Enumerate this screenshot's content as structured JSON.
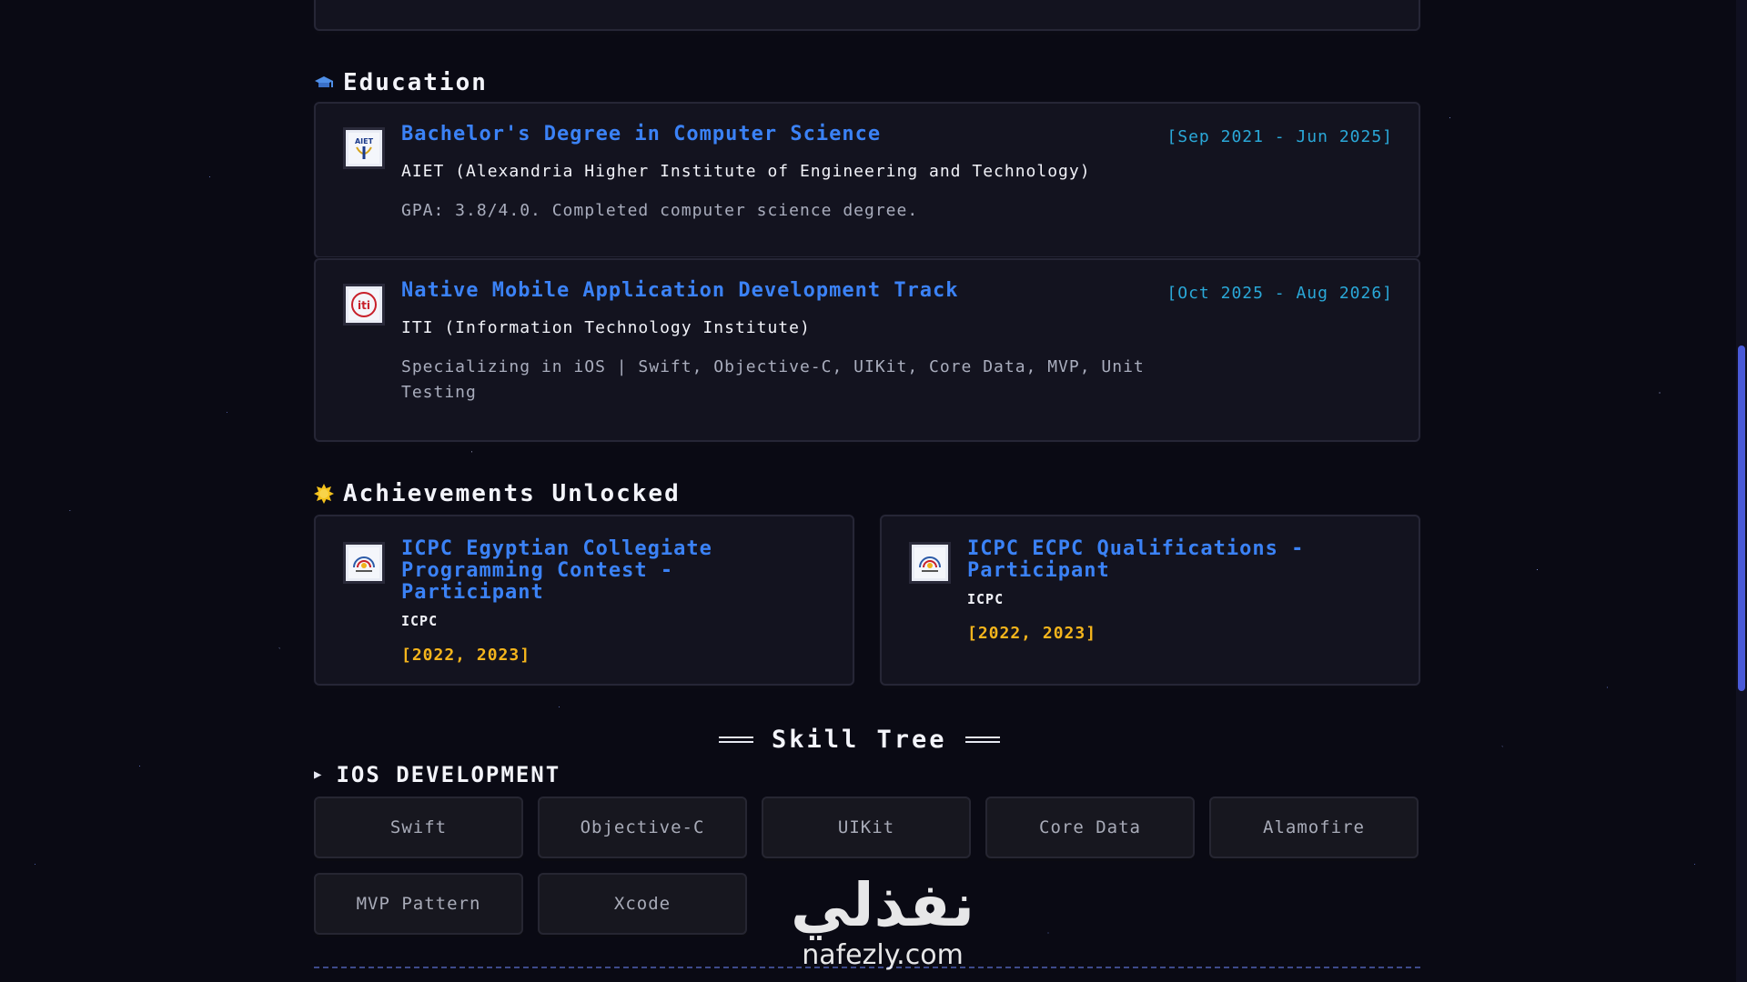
{
  "education": {
    "title": "Education",
    "entries": [
      {
        "logo_text": "AIET",
        "title": "Bachelor's Degree in Computer Science",
        "date": "[Sep 2021 - Jun 2025]",
        "org": "AIET (Alexandria Higher Institute of Engineering and Technology)",
        "desc": "GPA: 3.8/4.0. Completed computer science degree."
      },
      {
        "logo_text": "iti",
        "title": "Native Mobile Application Development Track",
        "date": "[Oct 2025 - Aug 2026]",
        "org": "ITI (Information Technology Institute)",
        "desc_line1": "Specializing in iOS | Swift, Objective-C, UIKit, Core Data, MVP, Unit",
        "desc_line2": "Testing"
      }
    ]
  },
  "achievements": {
    "title": "Achievements Unlocked",
    "items": [
      {
        "title_line1": "ICPC Egyptian Collegiate",
        "title_line2": "Programming Contest -",
        "title_line3": "Participant",
        "org": "ICPC",
        "years": "[2022, 2023]"
      },
      {
        "title_line1": "ICPC ECPC Qualifications -",
        "title_line2": "Participant",
        "org": "ICPC",
        "years": "[2022, 2023]"
      }
    ]
  },
  "skill_tree": {
    "title": "Skill Tree",
    "category": "IOS DEVELOPMENT",
    "skills": [
      "Swift",
      "Objective-C",
      "UIKit",
      "Core Data",
      "Alamofire",
      "MVP Pattern",
      "Xcode"
    ]
  },
  "watermark": {
    "arabic": "نفذلي",
    "domain": "nafezly.com"
  },
  "colors": {
    "accent_blue": "#3b82f6",
    "date_cyan": "#2aa8d8",
    "gold": "#f5b51c",
    "background": "#0a0a14",
    "card": "#13131f"
  }
}
